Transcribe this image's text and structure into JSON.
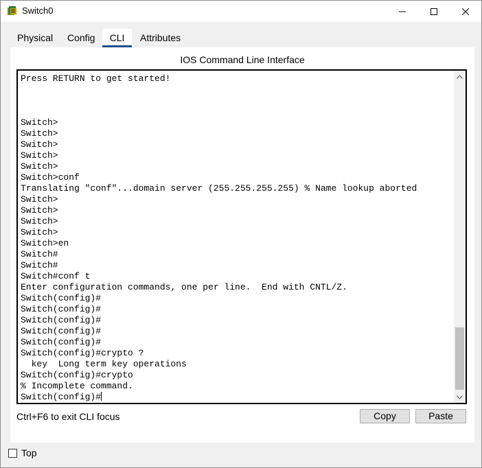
{
  "window": {
    "title": "Switch0",
    "controls": {
      "minimize": "minimize-icon",
      "maximize": "maximize-icon",
      "close": "close-icon"
    }
  },
  "tabs": [
    {
      "label": "Physical",
      "active": false
    },
    {
      "label": "Config",
      "active": false
    },
    {
      "label": "CLI",
      "active": true
    },
    {
      "label": "Attributes",
      "active": false
    }
  ],
  "panel": {
    "title": "IOS Command Line Interface",
    "terminal_lines": [
      "Press RETURN to get started!",
      "",
      "",
      "",
      "Switch>",
      "Switch>",
      "Switch>",
      "Switch>",
      "Switch>",
      "Switch>conf",
      "Translating \"conf\"...domain server (255.255.255.255) % Name lookup aborted",
      "Switch>",
      "Switch>",
      "Switch>",
      "Switch>",
      "Switch>en",
      "Switch#",
      "Switch#",
      "Switch#conf t",
      "Enter configuration commands, one per line.  End with CNTL/Z.",
      "Switch(config)#",
      "Switch(config)#",
      "Switch(config)#",
      "Switch(config)#",
      "Switch(config)#",
      "Switch(config)#crypto ?",
      "  key  Long term key operations",
      "Switch(config)#crypto",
      "% Incomplete command.",
      "Switch(config)#"
    ],
    "hint": "Ctrl+F6 to exit CLI focus",
    "copy_label": "Copy",
    "paste_label": "Paste"
  },
  "footer": {
    "top_label": "Top",
    "top_checked": false
  }
}
